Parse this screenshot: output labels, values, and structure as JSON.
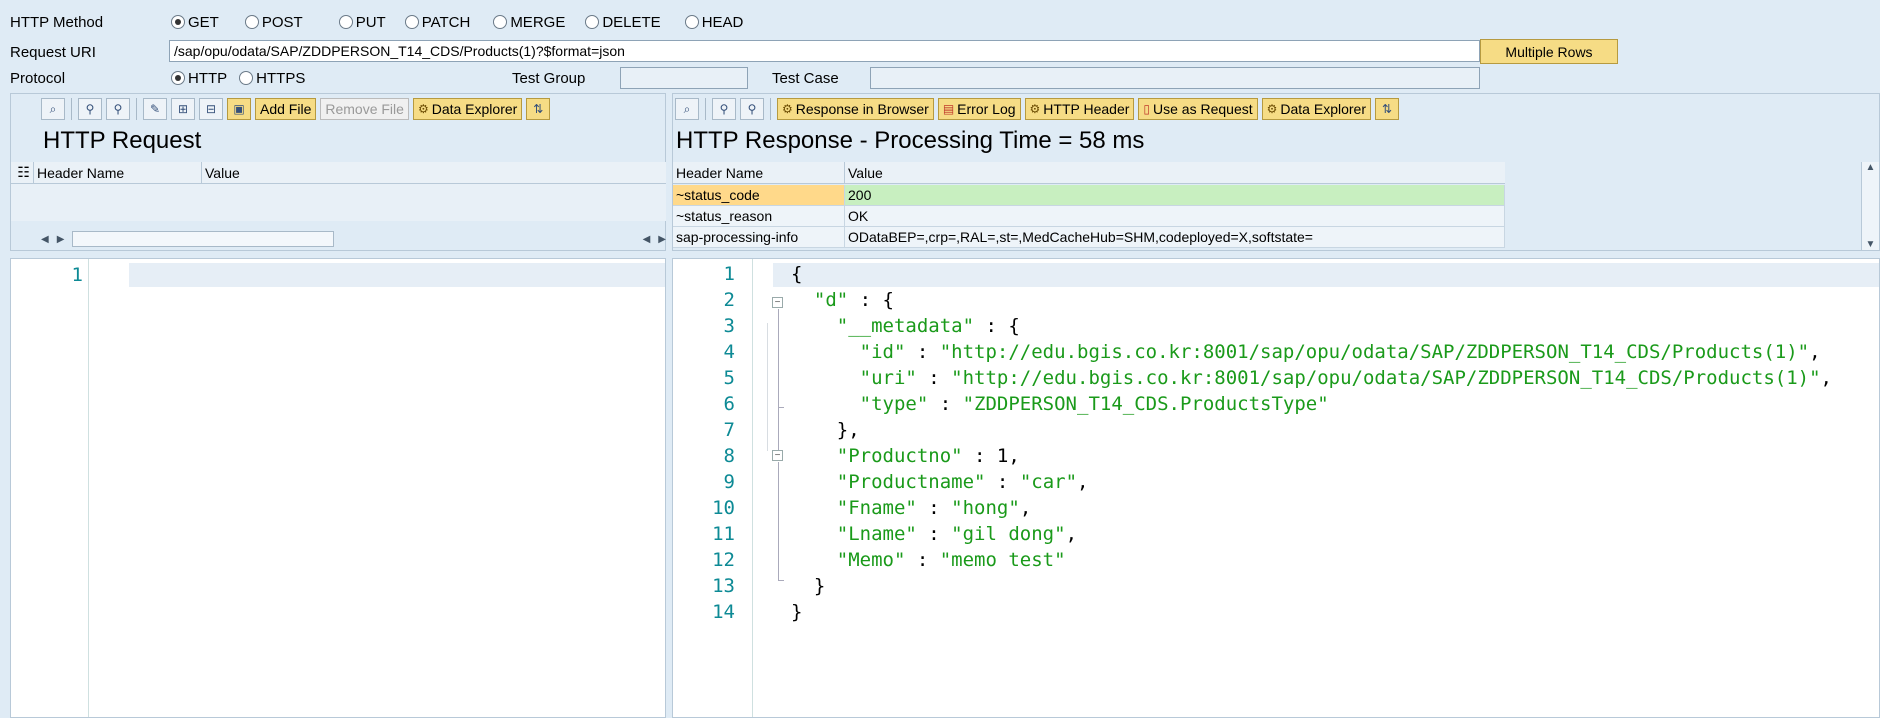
{
  "form": {
    "http_method_label": "HTTP Method",
    "methods": [
      "GET",
      "POST",
      "PUT",
      "PATCH",
      "MERGE",
      "DELETE",
      "HEAD"
    ],
    "selected_method": "GET",
    "request_uri_label": "Request URI",
    "request_uri": "/sap/opu/odata/SAP/ZDDPERSON_T14_CDS/Products(1)?$format=json",
    "multiple_rows_label": "Multiple Rows",
    "protocol_label": "Protocol",
    "protocols": [
      "HTTP",
      "HTTPS"
    ],
    "selected_protocol": "HTTP",
    "test_group_label": "Test Group",
    "test_group_value": "",
    "test_case_label": "Test Case",
    "test_case_value": ""
  },
  "request": {
    "toolbar": {
      "add_file": "Add File",
      "remove_file": "Remove File",
      "data_explorer": "Data Explorer"
    },
    "title": "HTTP Request",
    "columns": [
      "Header Name",
      "Value"
    ],
    "editor_lines": [
      "1"
    ]
  },
  "response": {
    "toolbar": {
      "response_in_browser": "Response in Browser",
      "error_log": "Error Log",
      "http_header": "HTTP Header",
      "use_as_request": "Use as Request",
      "data_explorer": "Data Explorer"
    },
    "title": "HTTP Response - Processing Time = 58  ms",
    "columns": [
      "Header Name",
      "Value"
    ],
    "headers": [
      {
        "name": "~status_code",
        "value": "200"
      },
      {
        "name": "~status_reason",
        "value": "OK"
      },
      {
        "name": "sap-processing-info",
        "value": "ODataBEP=,crp=,RAL=,st=,MedCacheHub=SHM,codeployed=X,softstate="
      }
    ],
    "line_numbers": [
      "1",
      "2",
      "3",
      "4",
      "5",
      "6",
      "7",
      "8",
      "9",
      "10",
      "11",
      "12",
      "13",
      "14"
    ],
    "code_lines": [
      "{",
      "  \"d\" : {",
      "    \"__metadata\" : {",
      "      \"id\" : \"http://edu.bgis.co.kr:8001/sap/opu/odata/SAP/ZDDPERSON_T14_CDS/Products(1)\",",
      "      \"uri\" : \"http://edu.bgis.co.kr:8001/sap/opu/odata/SAP/ZDDPERSON_T14_CDS/Products(1)\",",
      "      \"type\" : \"ZDDPERSON_T14_CDS.ProductsType\"",
      "    },",
      "    \"Productno\" : 1,",
      "    \"Productname\" : \"car\",",
      "    \"Fname\" : \"hong\",",
      "    \"Lname\" : \"gil dong\",",
      "    \"Memo\" : \"memo test\"",
      "  }",
      "}"
    ]
  },
  "colors": {
    "background": "#dfebf5",
    "button_yellow": "#f6dc85",
    "status_code_highlight": "#ffd98a",
    "status_value_highlight": "#c8efc0",
    "json_string": "#1a9a1a",
    "line_number": "#0d8a95"
  }
}
